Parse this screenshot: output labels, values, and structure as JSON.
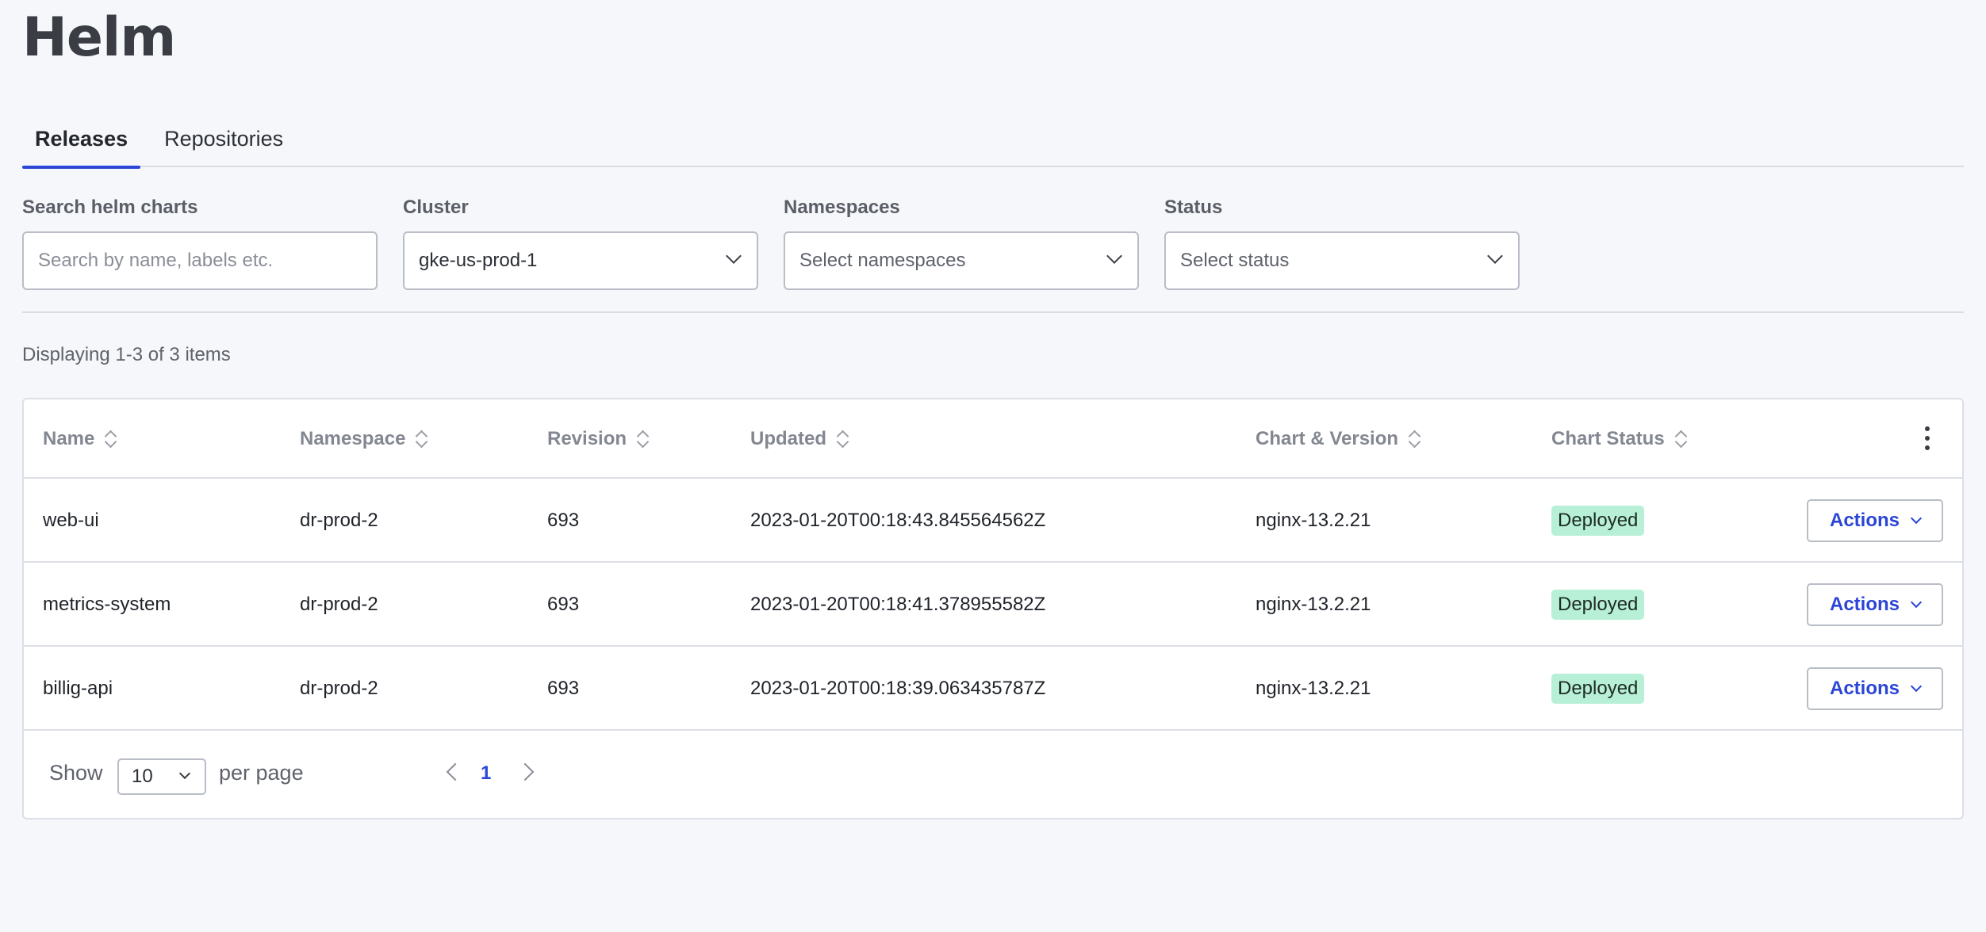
{
  "page": {
    "title": "Helm"
  },
  "tabs": [
    {
      "label": "Releases",
      "active": true
    },
    {
      "label": "Repositories",
      "active": false
    }
  ],
  "filters": {
    "search": {
      "label": "Search helm charts",
      "placeholder": "Search by name, labels etc.",
      "value": ""
    },
    "cluster": {
      "label": "Cluster",
      "value": "gke-us-prod-1"
    },
    "namespaces": {
      "label": "Namespaces",
      "placeholder": "Select namespaces"
    },
    "status": {
      "label": "Status",
      "placeholder": "Select status"
    }
  },
  "summary": "Displaying 1-3 of 3 items",
  "table": {
    "columns": [
      "Name",
      "Namespace",
      "Revision",
      "Updated",
      "Chart & Version",
      "Chart Status"
    ],
    "rows": [
      {
        "name": "web-ui",
        "namespace": "dr-prod-2",
        "revision": "693",
        "updated": "2023-01-20T00:18:43.845564562Z",
        "chart": "nginx-13.2.21",
        "status": "Deployed",
        "action": "Actions"
      },
      {
        "name": "metrics-system",
        "namespace": "dr-prod-2",
        "revision": "693",
        "updated": "2023-01-20T00:18:41.378955582Z",
        "chart": "nginx-13.2.21",
        "status": "Deployed",
        "action": "Actions"
      },
      {
        "name": "billig-api",
        "namespace": "dr-prod-2",
        "revision": "693",
        "updated": "2023-01-20T00:18:39.063435787Z",
        "chart": "nginx-13.2.21",
        "status": "Deployed",
        "action": "Actions"
      }
    ]
  },
  "pagination": {
    "show_label": "Show",
    "per_page_value": "10",
    "per_page_label": "per page",
    "current_page": "1"
  },
  "colors": {
    "accent": "#2b45d6",
    "badge_deployed": "#b7f0d6",
    "background": "#f6f7fb"
  },
  "icons": [
    "chevron-down-icon",
    "sort-icon",
    "kebab-menu-icon",
    "chevron-left-icon",
    "chevron-right-icon"
  ]
}
